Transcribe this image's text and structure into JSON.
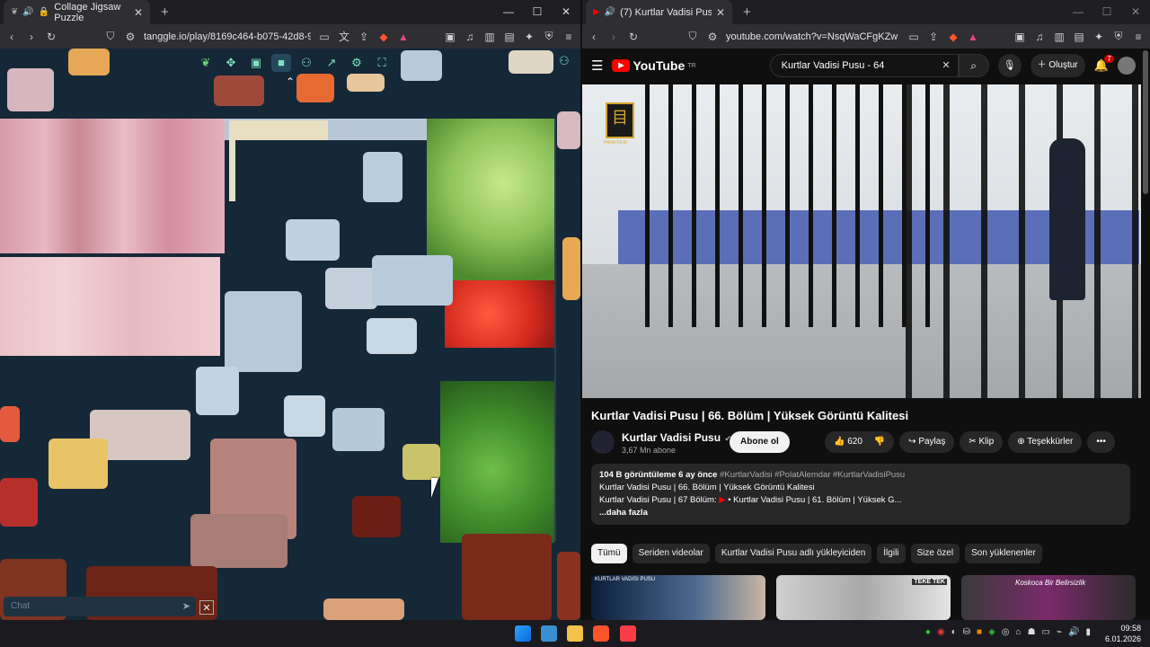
{
  "left_window": {
    "tab_title": "Collage Jigsaw Puzzle",
    "url": "tanggle.io/play/8169c464-b075-42d8-9bef...",
    "chat_placeholder": "Chat"
  },
  "right_window": {
    "tab_title": "(7) Kurtlar Vadisi Pusu | 66. Bö",
    "url": "youtube.com/watch?v=NsqWaCFgKZw",
    "search_value": "Kurtlar Vadisi Pusu - 64",
    "create_label": "Oluştur",
    "notification_count": "7",
    "logo_text": "YouTube",
    "logo_region": "TR",
    "video_watermark": "PANA FILM",
    "video_title": "Kurtlar Vadisi Pusu | 66. Bölüm | Yüksek Görüntü Kalitesi",
    "channel_name": "Kurtlar Vadisi Pusu",
    "channel_subs": "3,67 Mn abone",
    "subscribe_label": "Abone ol",
    "like_count": "620",
    "share_label": "Paylaş",
    "clip_label": "Klip",
    "thanks_label": "Teşekkürler",
    "desc_meta": "104 B görüntüleme  6 ay önce",
    "desc_tags": "#KurtlarVadisi #PolatAlemdar #KurtlarVadisiPusu",
    "desc_line2": "Kurtlar Vadisi Pusu | 66. Bölüm | Yüksek Görüntü Kalitesi",
    "desc_line3_prefix": "Kurtlar Vadisi Pusu | 67 Bölüm:",
    "desc_line3_link": "• Kurtlar Vadisi Pusu | 61. Bölüm | Yüksek G...",
    "desc_more": "...daha fazla",
    "chips": [
      "Tümü",
      "Seriden videolar",
      "Kurtlar Vadisi Pusu adlı yükleyiciden",
      "İlgili",
      "Size özel",
      "Son yüklenenler"
    ],
    "thumb_texts": [
      "KURTLAR VADISI PUSU",
      "TEKE TEK",
      "Koskoca Bir Belirsizlik"
    ]
  },
  "taskbar": {
    "time": "09:58",
    "date": "6.01.2026"
  },
  "colors": {
    "puzzle_bg": "#152838",
    "youtube_red": "#ff0000",
    "brave_orange": "#fb542b"
  }
}
